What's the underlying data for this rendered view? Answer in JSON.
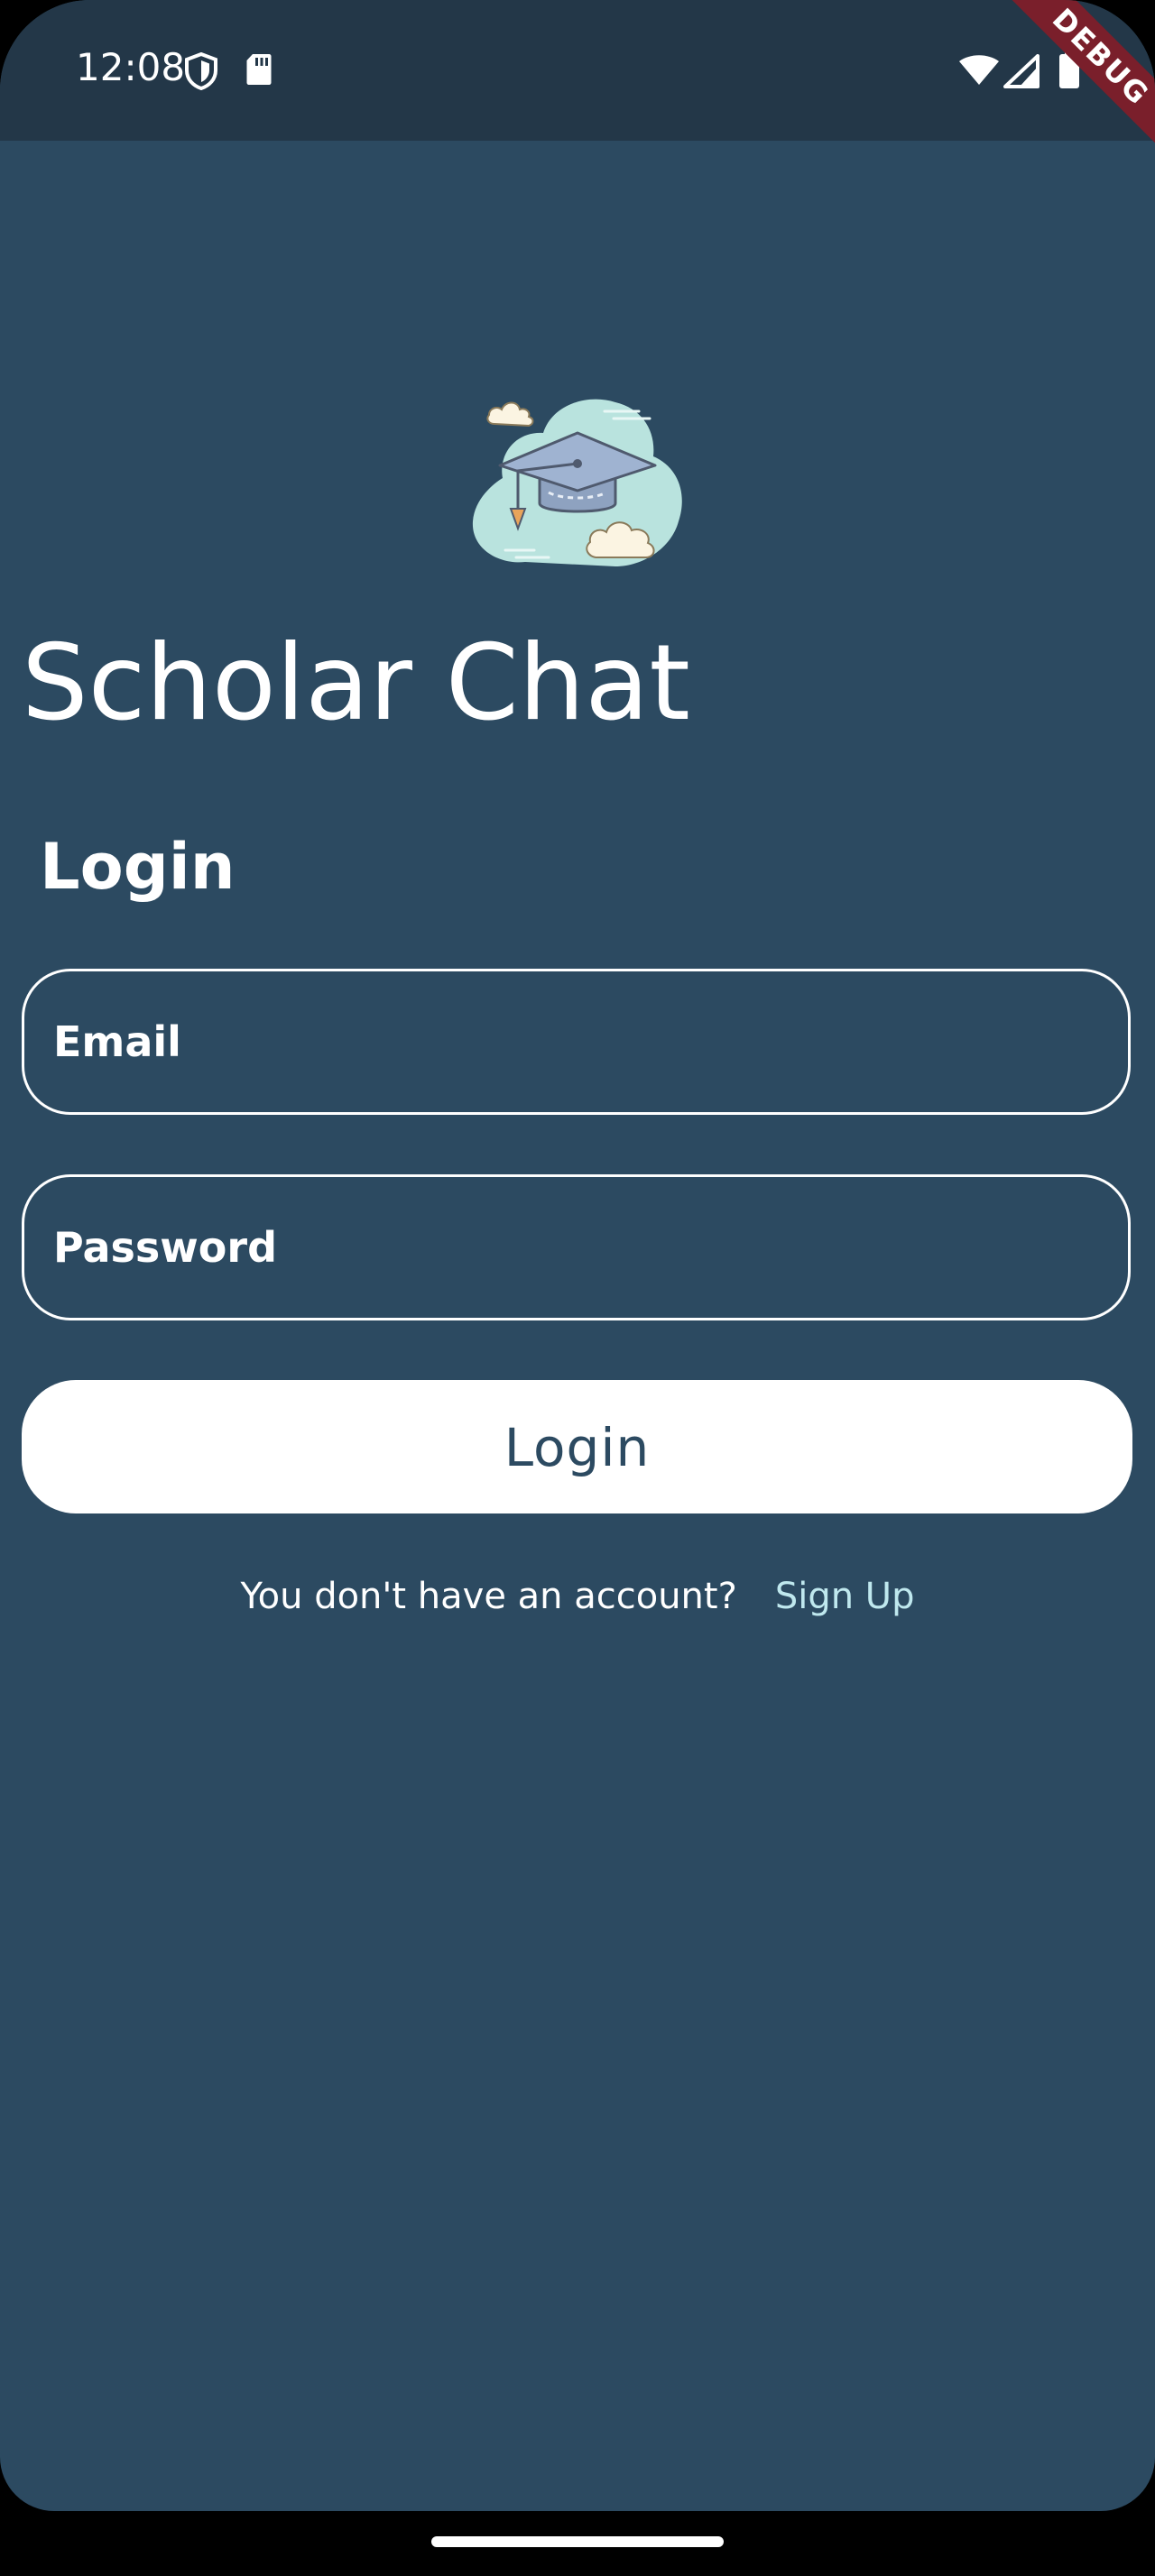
{
  "status_bar": {
    "time": "12:08",
    "icons": [
      "shield-icon",
      "sd-card-icon",
      "wifi-icon",
      "cell-signal-icon",
      "battery-icon"
    ]
  },
  "debug_banner": "DEBUG",
  "app": {
    "logo_icon": "graduation-cap-cloud-icon",
    "title": "Scholar Chat"
  },
  "login_form": {
    "heading": "Login",
    "email_placeholder": "Email",
    "password_placeholder": "Password",
    "submit_label": "Login",
    "signup_prompt": "You don't have an account?",
    "signup_link": "Sign Up"
  },
  "colors": {
    "background": "#2c4a61",
    "status_bar": "#233748",
    "button_bg": "#ffffff",
    "button_text": "#2c4a61",
    "link": "#bfe8ee",
    "debug": "#7a1f2b"
  }
}
